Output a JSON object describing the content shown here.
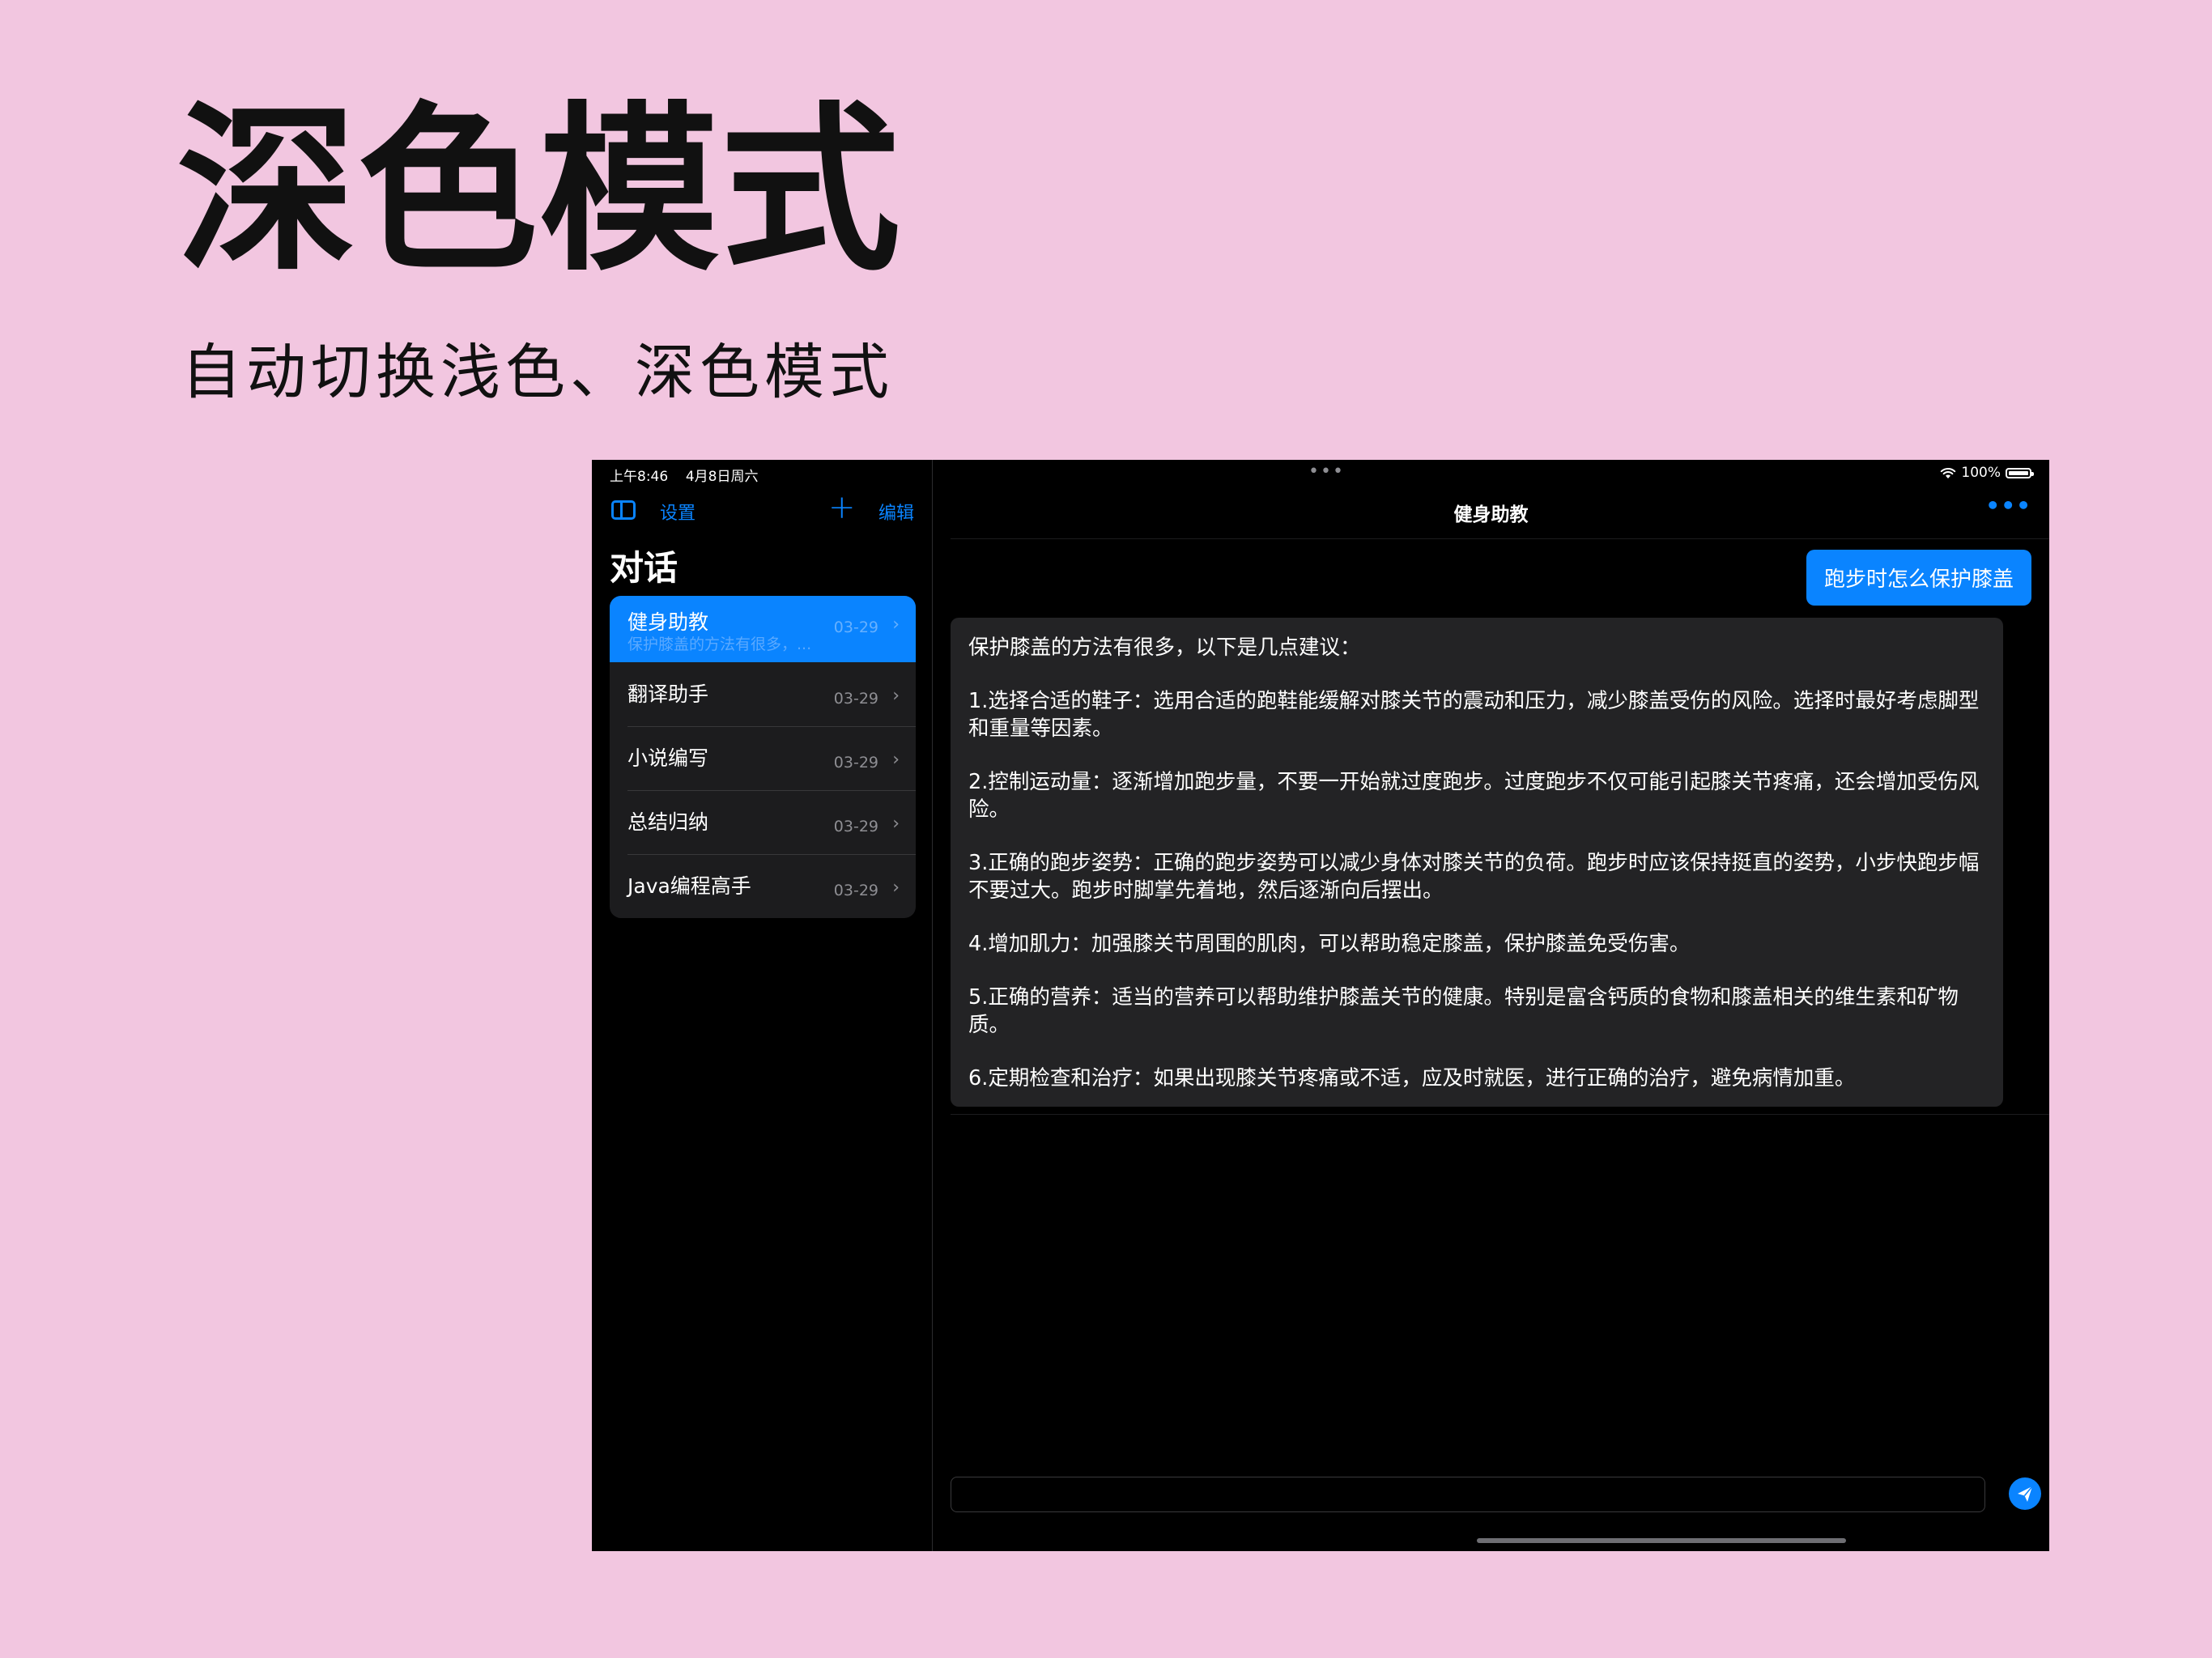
{
  "hero": {
    "title": "深色模式",
    "subtitle": "自动切换浅色、深色模式"
  },
  "status_bar": {
    "time": "上午8:46",
    "date": "4月8日周六",
    "center_dots": "•••",
    "battery": "100%"
  },
  "sidebar": {
    "settings_label": "设置",
    "plus_label": "+",
    "edit_label": "编辑",
    "heading": "对话",
    "conversations": [
      {
        "title": "健身助教",
        "preview": "保护膝盖的方法有很多，...",
        "date": "03-29",
        "active": true
      },
      {
        "title": "翻译助手",
        "date": "03-29"
      },
      {
        "title": "小说编写",
        "date": "03-29"
      },
      {
        "title": "总结归纳",
        "date": "03-29"
      },
      {
        "title": "Java编程高手",
        "date": "03-29"
      }
    ]
  },
  "chat": {
    "title": "健身助教",
    "more_label": "•••",
    "user_message": "跑步时怎么保护膝盖",
    "bot_paragraphs": [
      "保护膝盖的方法有很多，以下是几点建议：",
      "1.选择合适的鞋子：选用合适的跑鞋能缓解对膝关节的震动和压力，减少膝盖受伤的风险。选择时最好考虑脚型和重量等因素。",
      "2.控制运动量：逐渐增加跑步量，不要一开始就过度跑步。过度跑步不仅可能引起膝关节疼痛，还会增加受伤风险。",
      "3.正确的跑步姿势：正确的跑步姿势可以减少身体对膝关节的负荷。跑步时应该保持挺直的姿势，小步快跑步幅不要过大。跑步时脚掌先着地，然后逐渐向后摆出。",
      "4.增加肌力：加强膝关节周围的肌肉，可以帮助稳定膝盖，保护膝盖免受伤害。",
      "5.正确的营养：适当的营养可以帮助维护膝盖关节的健康。特别是富含钙质的食物和膝盖相关的维生素和矿物质。",
      "6.定期检查和治疗：如果出现膝关节疼痛或不适，应及时就医，进行正确的治疗，避免病情加重。"
    ],
    "input_value": ""
  },
  "colors": {
    "background": "#f2c6e0",
    "accent": "#0a84ff",
    "screen": "#000000",
    "bubble_bot": "#232325"
  },
  "icons": {
    "sidebar_toggle": "sidebar-toggle-icon",
    "plus": "plus-icon",
    "more": "ellipsis-icon",
    "chevron": "chevron-right-icon",
    "send": "paper-plane-icon",
    "wifi": "wifi-icon",
    "battery": "battery-icon"
  }
}
